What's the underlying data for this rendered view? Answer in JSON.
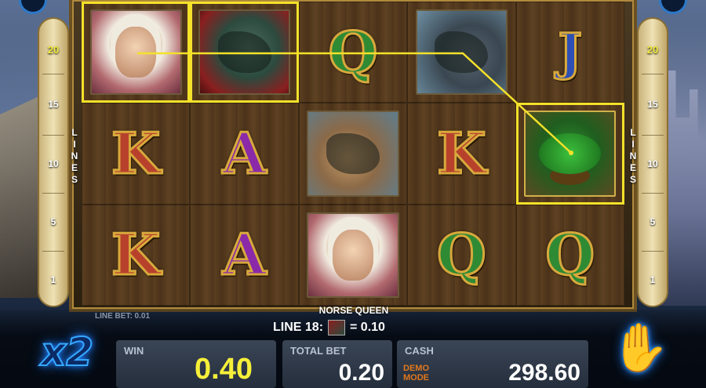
{
  "game": {
    "title": "NORSE QUEEN"
  },
  "reels": [
    [
      "queen",
      "dragon",
      "Q",
      "elk",
      "J"
    ],
    [
      "K",
      "A",
      "ram",
      "K",
      "tree"
    ],
    [
      "K",
      "A",
      "queen",
      "Q",
      "Q"
    ]
  ],
  "highlighted_cells": [
    "0-0",
    "0-1",
    "1-4"
  ],
  "lines": {
    "label_left": "LINES",
    "label_right": "LINES",
    "left_numbers": [
      "20",
      "15",
      "10",
      "5",
      "1"
    ],
    "right_numbers": [
      "20",
      "15",
      "10",
      "5",
      "1"
    ]
  },
  "status": {
    "line_bet": "LINE BET: 0.01",
    "line_win_label": "LINE 18:",
    "line_win_value": "= 0.10"
  },
  "panels": {
    "win_label": "WIN",
    "win_value": "0.40",
    "total_bet_label": "TOTAL BET",
    "total_bet_value": "0.20",
    "cash_label": "CASH",
    "cash_value": "298.60",
    "demo_mode": "DEMO\nMODE"
  },
  "multiplier": "x2",
  "colors": {
    "highlight": "#f4e12a",
    "win_value": "#f6ef3a",
    "demo": "#e0781e",
    "neon": "#36a8ff"
  },
  "icons": {
    "spin_button": "hand-icon"
  }
}
